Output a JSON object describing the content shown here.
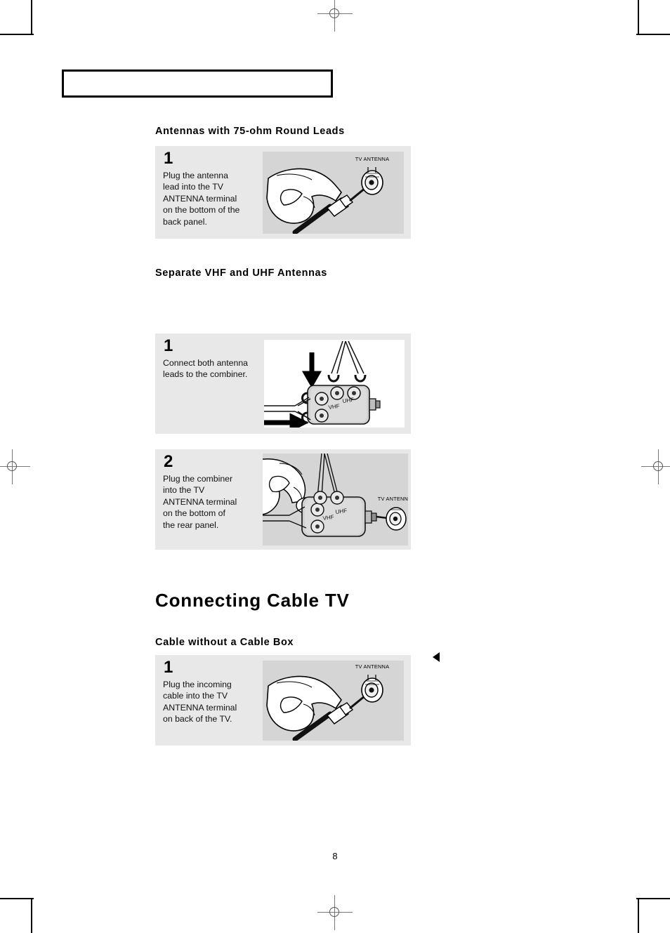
{
  "document": {
    "page_number": "8",
    "header_box_text": ""
  },
  "sections": {
    "antenna_round_leads": {
      "heading": "Antennas with 75-ohm Round Leads",
      "steps": [
        {
          "number": "1",
          "text": "Plug the antenna\nlead into the TV\nANTENNA terminal\non the bottom of the\nback panel.",
          "art_label": "TV ANTENNA"
        }
      ]
    },
    "separate_vhf_uhf": {
      "heading": "Separate VHF and UHF Antennas",
      "steps": [
        {
          "number": "1",
          "text": "Connect both antenna\nleads to the combiner.",
          "art_labels": {
            "vhf": "VHF",
            "uhf": "UHF"
          }
        },
        {
          "number": "2",
          "text": "Plug the combiner\ninto the TV\nANTENNA terminal\non the bottom of\nthe rear panel.",
          "art_labels": {
            "vhf": "VHF",
            "uhf": "UHF",
            "terminal": "TV ANTENNA"
          }
        }
      ]
    },
    "connecting_cable_tv": {
      "heading": "Connecting Cable TV",
      "subheading": "Cable without a Cable Box",
      "steps": [
        {
          "number": "1",
          "text": "Plug the incoming\ncable into the TV\nANTENNA terminal\non back of the TV.",
          "art_label": "TV ANTENNA"
        }
      ]
    }
  },
  "colors": {
    "panel_background": "#e8e8e8",
    "art_background": "#d5d5d5",
    "text": "#111111",
    "rule": "#000000"
  }
}
